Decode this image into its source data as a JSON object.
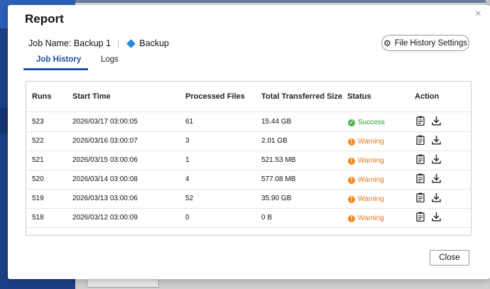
{
  "modal": {
    "title": "Report",
    "close_glyph": "×",
    "job_name_label": "Job Name: Backup 1",
    "job_type_label": "Backup",
    "file_history_button": "File History Settings",
    "tabs": [
      {
        "label": "Job History",
        "active": true
      },
      {
        "label": "Logs",
        "active": false
      }
    ],
    "close_button": "Close"
  },
  "table": {
    "headers": [
      "Runs",
      "Start Time",
      "Processed Files",
      "Total Transferred Size",
      "Status",
      "Action"
    ],
    "rows": [
      {
        "runs": "523",
        "start": "2026/03/17 03:00:05",
        "files": "61",
        "size": "15.44 GB",
        "status": "Success"
      },
      {
        "runs": "522",
        "start": "2026/03/16 03:00:07",
        "files": "3",
        "size": "2.01 GB",
        "status": "Warning"
      },
      {
        "runs": "521",
        "start": "2026/03/15 03:00:06",
        "files": "1",
        "size": "521.53 MB",
        "status": "Warning"
      },
      {
        "runs": "520",
        "start": "2026/03/14 03:00:08",
        "files": "4",
        "size": "577.08 MB",
        "status": "Warning"
      },
      {
        "runs": "519",
        "start": "2026/03/13 03:00:06",
        "files": "52",
        "size": "35.90 GB",
        "status": "Warning"
      },
      {
        "runs": "518",
        "start": "2026/03/12 03:00:09",
        "files": "0",
        "size": "0 B",
        "status": "Warning"
      }
    ]
  },
  "colors": {
    "accent": "#1f52b0",
    "success": "#4bb34b",
    "warning": "#f08a24",
    "job_diamond": "#2a86d6"
  },
  "icons": [
    "close-icon",
    "gear-icon",
    "diamond-icon",
    "success-icon",
    "warning-icon",
    "clipboard-icon",
    "download-icon"
  ]
}
